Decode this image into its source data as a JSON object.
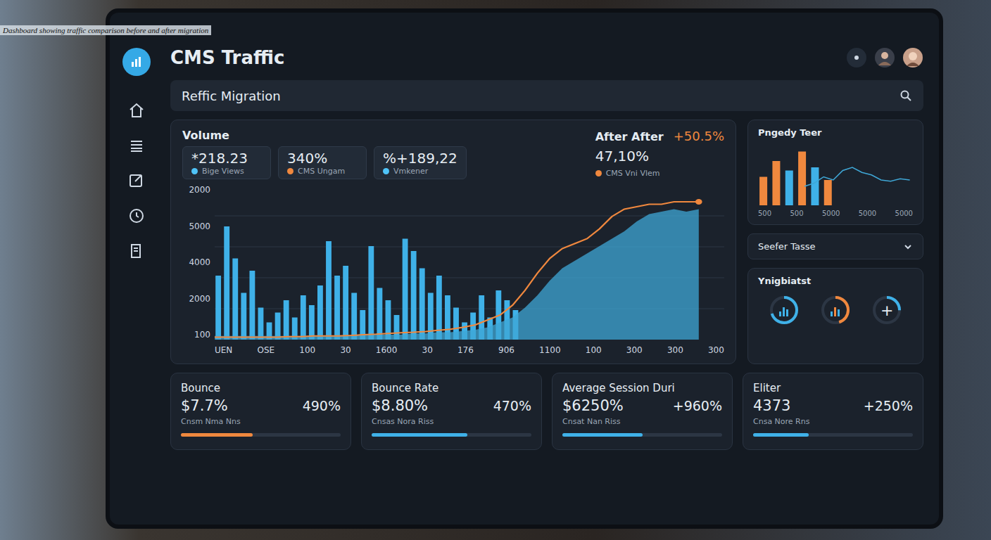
{
  "caption": "Dashboard showing traffic comparison before and after migration",
  "app": {
    "title": "CMS Traffic"
  },
  "search": {
    "value": "Reffic Migration"
  },
  "volume": {
    "title": "Volume",
    "stats": [
      {
        "value": "*218.23",
        "label": "Bige Views",
        "color": "#4fc3f7"
      },
      {
        "value": "340%",
        "label": "CMS Ungam",
        "color": "#f0883e"
      },
      {
        "value": "%+189,22",
        "label": "Vmkener",
        "color": "#4fc3f7"
      }
    ]
  },
  "after": {
    "title": "After After",
    "value": "47,10%",
    "label": "CMS Vni Vlem",
    "color": "#f0883e",
    "change": "+50.5%"
  },
  "chart": {
    "max": 6000,
    "y_ticks": [
      "2000",
      "5000",
      "4000",
      "2000",
      "100"
    ],
    "x_ticks": [
      "UEN",
      "OSE",
      "100",
      "30",
      "1600",
      "30",
      "176",
      "906",
      "1100",
      "100",
      "300",
      "300",
      "300"
    ],
    "bars": {
      "color": "#3fb1e8",
      "values": [
        2600,
        4600,
        3300,
        1900,
        2800,
        1300,
        700,
        1100,
        1600,
        900,
        1800,
        1400,
        2200,
        4000,
        2600,
        3000,
        1900,
        1200,
        3800,
        2100,
        1600,
        1000,
        4100,
        3600,
        2900,
        1900,
        2600,
        1800,
        1300,
        700,
        1100,
        1800,
        900,
        2000,
        1600,
        1200
      ]
    },
    "area": {
      "color": "#3fa7d6",
      "values": [
        150,
        150,
        150,
        150,
        150,
        150,
        150,
        150,
        150,
        150,
        150,
        150,
        200,
        200,
        200,
        200,
        250,
        250,
        300,
        300,
        350,
        400,
        500,
        700,
        900,
        1300,
        1800,
        2400,
        2900,
        3200,
        3500,
        3800,
        4100,
        4400,
        4800,
        5100,
        5200,
        5300,
        5200,
        5300
      ]
    },
    "line": {
      "color": "#f0883e",
      "values": [
        100,
        100,
        100,
        100,
        100,
        100,
        120,
        120,
        150,
        150,
        150,
        170,
        200,
        220,
        250,
        280,
        300,
        330,
        380,
        420,
        500,
        600,
        800,
        1000,
        1400,
        2000,
        2700,
        3300,
        3700,
        3900,
        4100,
        4500,
        5000,
        5300,
        5400,
        5500,
        5500,
        5600,
        5600,
        5600
      ]
    }
  },
  "mini_chart": {
    "title": "Pngedy Teer",
    "max": 100,
    "bars": [
      {
        "value": 45,
        "color": "#f0883e"
      },
      {
        "value": 70,
        "color": "#f0883e"
      },
      {
        "value": 55,
        "color": "#3fb1e8"
      },
      {
        "value": 85,
        "color": "#f0883e"
      },
      {
        "value": 60,
        "color": "#3fb1e8"
      },
      {
        "value": 40,
        "color": "#f0883e"
      }
    ],
    "line": [
      30,
      35,
      45,
      40,
      55,
      60,
      52,
      48,
      40,
      38,
      42,
      40
    ],
    "x_ticks": [
      "500",
      "500",
      "5000",
      "5000",
      "5000"
    ]
  },
  "dropdown": {
    "value": "Seefer Tasse"
  },
  "gauges": {
    "title": "Ynigbiatst",
    "items": [
      {
        "level": 0.7,
        "color": "#3fb1e8",
        "symbol": ""
      },
      {
        "level": 0.45,
        "color": "#f0883e",
        "symbol": ""
      },
      {
        "level": 0.25,
        "color": "#3fb1e8",
        "symbol": "+"
      }
    ]
  },
  "metrics": [
    {
      "title": "Bounce",
      "value": "$7.7%",
      "change": "490%",
      "sub": "Cnsm Nma Nns",
      "level": 0.45,
      "color": "#f0883e"
    },
    {
      "title": "Bounce Rate",
      "value": "$8.80%",
      "change": "470%",
      "sub": "Cnsas Nora Riss",
      "level": 0.6,
      "color": "#3fb1e8"
    },
    {
      "title": "Average Session Duri",
      "value": "$6250%",
      "change": "+960%",
      "sub": "Cnsat Nan Riss",
      "level": 0.5,
      "color": "#3fb1e8"
    },
    {
      "title": "Eliter",
      "value": "4373",
      "change": "+250%",
      "sub": "Cnsa Nore Rns",
      "level": 0.35,
      "color": "#3fb1e8"
    }
  ]
}
